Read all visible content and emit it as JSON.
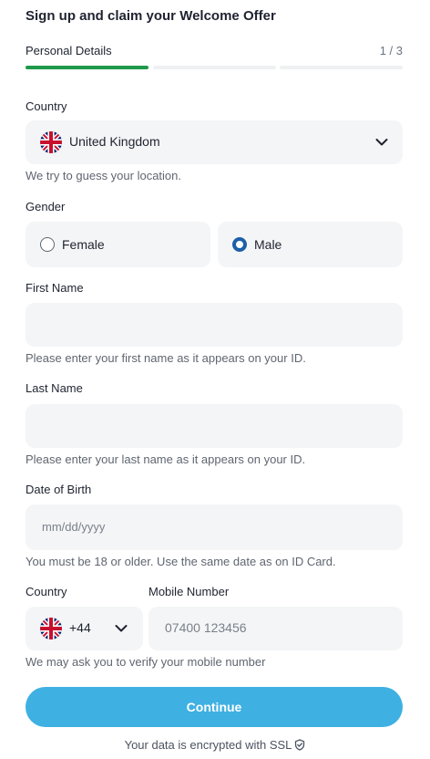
{
  "header": {
    "title": "Sign up and claim your Welcome Offer",
    "step_name": "Personal Details",
    "step_count": "1 / 3",
    "progress": {
      "current_step": 1,
      "total_steps": 3
    }
  },
  "country": {
    "label": "Country",
    "value": "United Kingdom",
    "flag": "uk-flag-icon",
    "hint": "We try to guess your location."
  },
  "gender": {
    "label": "Gender",
    "options": [
      {
        "label": "Female",
        "checked": false
      },
      {
        "label": "Male",
        "checked": true
      }
    ]
  },
  "first_name": {
    "label": "First Name",
    "value": "",
    "hint": "Please enter your first name as it appears on your ID."
  },
  "last_name": {
    "label": "Last Name",
    "value": "",
    "hint": "Please enter your last name as it appears on your ID."
  },
  "dob": {
    "label": "Date of Birth",
    "placeholder": "mm/dd/yyyy",
    "hint": "You must be 18 or older. Use the same date as on ID Card."
  },
  "phone": {
    "country_label": "Country",
    "number_label": "Mobile Number",
    "code": "+44",
    "placeholder": "07400 123456",
    "hint": "We may ask you to verify your mobile number"
  },
  "actions": {
    "continue_label": "Continue"
  },
  "footer": {
    "ssl_text": "Your data is encrypted with SSL",
    "ssl_icon": "shield-check-icon"
  },
  "colors": {
    "progress_active": "#1f9a4a",
    "button": "#3fb0e2",
    "radio_checked": "#1d5fa8",
    "field_bg": "#f4f5f6"
  }
}
